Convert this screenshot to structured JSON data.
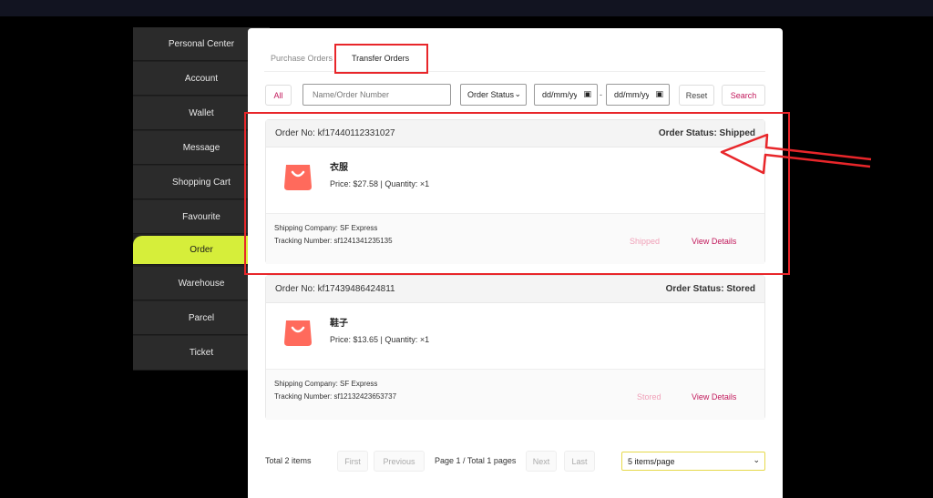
{
  "sidebar": {
    "items": [
      {
        "label": "Personal Center"
      },
      {
        "label": "Account"
      },
      {
        "label": "Wallet"
      },
      {
        "label": "Message"
      },
      {
        "label": "Shopping Cart"
      },
      {
        "label": "Favourite"
      },
      {
        "label": "Order",
        "active": true
      },
      {
        "label": "Warehouse"
      },
      {
        "label": "Parcel"
      },
      {
        "label": "Ticket"
      }
    ]
  },
  "tabs": [
    {
      "label": "Purchase Orders"
    },
    {
      "label": "Transfer Orders",
      "active": true
    }
  ],
  "filters": {
    "all_label": "All",
    "search_placeholder": "Name/Order Number",
    "status_select": "Order Status",
    "date_from": "dd/mm/yyyy",
    "date_sep": "-",
    "date_to": "dd/mm/yyyy",
    "reset_label": "Reset",
    "search_label": "Search"
  },
  "orders": [
    {
      "order_no": "Order No: kf17440112331027",
      "status_header": "Order Status: Shipped",
      "product_name": "衣服",
      "price_qty": "Price: $27.58 | Quantity: ×1",
      "shipping_company": "Shipping Company: SF Express",
      "tracking": "Tracking Number: sf1241341235135",
      "status": "Shipped",
      "details_label": "View Details"
    },
    {
      "order_no": "Order No: kf17439486424811",
      "status_header": "Order Status: Stored",
      "product_name": "鞋子",
      "price_qty": "Price: $13.65 | Quantity: ×1",
      "shipping_company": "Shipping Company: SF Express",
      "tracking": "Tracking Number: sf12132423653737",
      "status": "Stored",
      "details_label": "View Details"
    }
  ],
  "pagination": {
    "total": "Total 2 items",
    "first": "First",
    "previous": "Previous",
    "page_info": "Page 1 / Total 1 pages",
    "next": "Next",
    "last": "Last",
    "per_page": "5 items/page"
  },
  "colors": {
    "accent": "#c2185b",
    "active_sidebar": "#d6ee3a",
    "annotation": "#e8262a",
    "bag_icon": "#ff6a5c"
  },
  "icons": [
    "shopping-bag-icon",
    "chevron-down-icon",
    "calendar-icon",
    "annotation-arrow-icon"
  ]
}
